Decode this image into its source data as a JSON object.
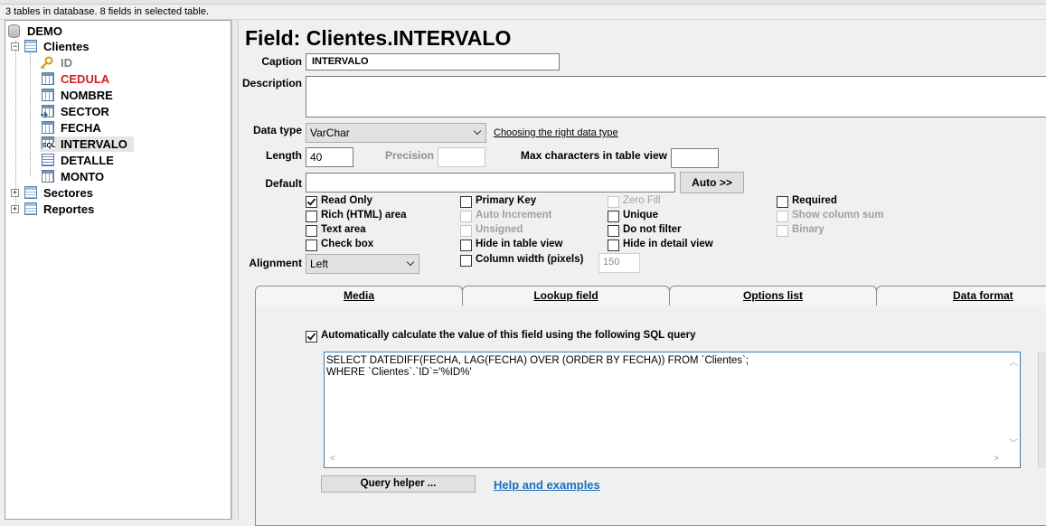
{
  "status": "3 tables in database. 8 fields in selected table.",
  "tree": {
    "root": "DEMO",
    "tables": [
      {
        "label": "Clientes"
      },
      {
        "label": "Sectores"
      },
      {
        "label": "Reportes"
      }
    ],
    "fields": [
      {
        "label": "ID",
        "icon": "key-icon"
      },
      {
        "label": "CEDULA",
        "icon": "field-icon"
      },
      {
        "label": "NOMBRE",
        "icon": "field-icon"
      },
      {
        "label": "SECTOR",
        "icon": "lookup-field-icon"
      },
      {
        "label": "FECHA",
        "icon": "field-icon"
      },
      {
        "label": "INTERVALO",
        "icon": "sql-field-icon"
      },
      {
        "label": "DETALLE",
        "icon": "memo-field-icon"
      },
      {
        "label": "MONTO",
        "icon": "field-icon"
      }
    ],
    "expanded_symbol": "−",
    "collapsed_symbol": "+"
  },
  "form": {
    "title": "Field: Clientes.INTERVALO",
    "caption_label": "Caption",
    "caption_value": "INTERVALO",
    "description_label": "Description",
    "description_value": "",
    "datatype_label": "Data type",
    "datatype_value": "VarChar",
    "datatype_link": "Choosing the right data type",
    "length_label": "Length",
    "length_value": "40",
    "precision_label": "Precision",
    "maxchars_label": "Max characters in table view",
    "maxchars_value": "",
    "default_label": "Default",
    "default_value": "",
    "auto_button": "Auto >>",
    "alignment_label": "Alignment",
    "alignment_value": "Left",
    "colwidth_value": "150"
  },
  "checkboxes": {
    "read_only": {
      "label": "Read Only",
      "checked": true
    },
    "rich_html": {
      "label": "Rich (HTML) area",
      "checked": false
    },
    "text_area": {
      "label": "Text area",
      "checked": false
    },
    "check_box": {
      "label": "Check box",
      "checked": false
    },
    "primary_key": {
      "label": "Primary Key",
      "checked": false
    },
    "auto_increment": {
      "label": "Auto Increment",
      "checked": false,
      "disabled": true
    },
    "unsigned": {
      "label": "Unsigned",
      "checked": false,
      "disabled": true
    },
    "hide_table": {
      "label": "Hide in table view",
      "checked": false
    },
    "column_width": {
      "label": "Column width (pixels)",
      "checked": false
    },
    "zero_fill": {
      "label": "Zero Fill",
      "checked": false,
      "disabled": true
    },
    "unique": {
      "label": "Unique",
      "checked": false
    },
    "do_not_filter": {
      "label": "Do not filter",
      "checked": false
    },
    "hide_detail": {
      "label": "Hide in detail view",
      "checked": false
    },
    "required": {
      "label": "Required",
      "checked": false
    },
    "show_sum": {
      "label": "Show column sum",
      "checked": false,
      "disabled": true
    },
    "binary": {
      "label": "Binary",
      "checked": false,
      "disabled": true
    }
  },
  "tabs": [
    "Media",
    "Lookup field",
    "Options list",
    "Data format"
  ],
  "sql_panel": {
    "auto_calc_label": "Automatically calculate the value of this field using the following SQL query",
    "auto_calc_checked": true,
    "query_lines": [
      "SELECT DATEDIFF(FECHA, LAG(FECHA) OVER (ORDER BY FECHA)) FROM `Clientes`;",
      "WHERE `Clientes`.`ID`='%ID%'"
    ],
    "query_helper_button": "Query helper ...",
    "help_link": "Help and examples"
  },
  "colors": {
    "danger_field": "#d21f1f",
    "key_field": "#808080",
    "link_blue": "#1c6fc0"
  }
}
